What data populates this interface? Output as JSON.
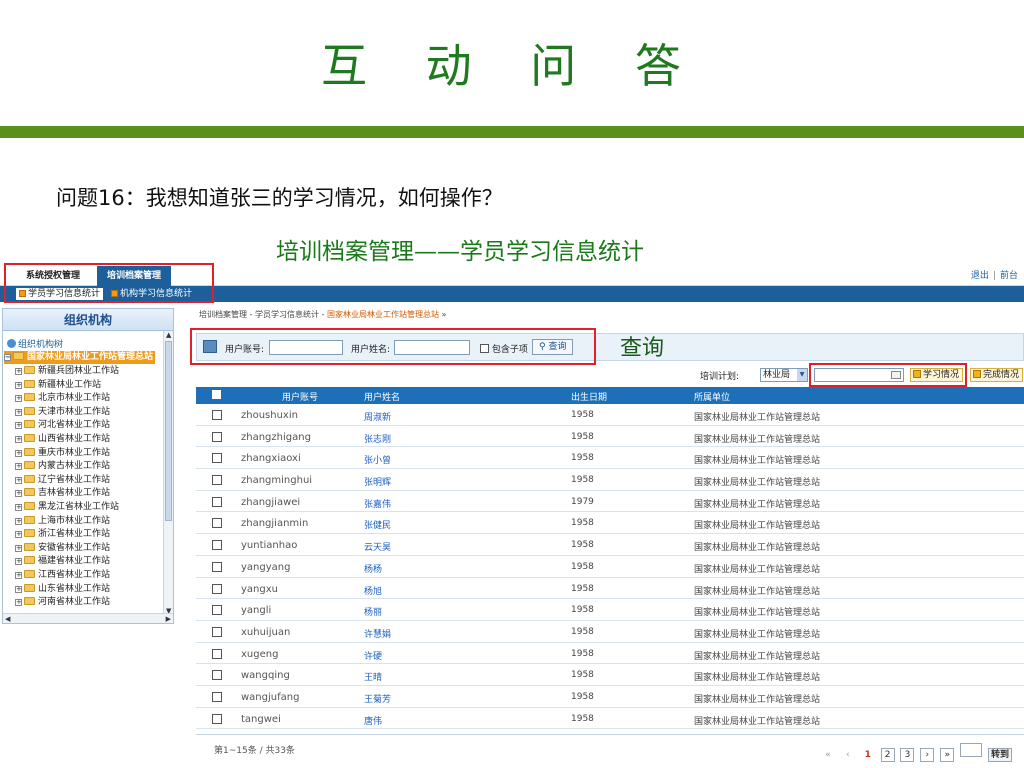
{
  "slide": {
    "title": "互 动 问 答",
    "question": "问题16：我想知道张三的学习情况，如何操作？",
    "subtitle": "培训档案管理——学员学习信息统计",
    "annotation_query": "查询"
  },
  "header": {
    "tabs": [
      {
        "label": "系统授权管理"
      },
      {
        "label": "培训档案管理"
      }
    ],
    "links": {
      "logout": "退出",
      "sep": "|",
      "home": "前台"
    }
  },
  "subnav": [
    {
      "label": "学员学习信息统计"
    },
    {
      "label": "机构学习信息统计"
    }
  ],
  "sidebar": {
    "title": "组织机构",
    "root": "组织机构树",
    "selected": "国家林业局林业工作站管理总站",
    "items": [
      "新疆兵团林业工作站",
      "新疆林业工作站",
      "北京市林业工作站",
      "天津市林业工作站",
      "河北省林业工作站",
      "山西省林业工作站",
      "重庆市林业工作站",
      "内蒙古林业工作站",
      "辽宁省林业工作站",
      "吉林省林业工作站",
      "黑龙江省林业工作站",
      "上海市林业工作站",
      "浙江省林业工作站",
      "安徽省林业工作站",
      "福建省林业工作站",
      "江西省林业工作站",
      "山东省林业工作站",
      "河南省林业工作站"
    ]
  },
  "breadcrumb": {
    "path": "培训档案管理 - 学员学习信息统计 - ",
    "current": "国家林业局林业工作站管理总站",
    "tail": " »"
  },
  "search": {
    "account_label": "用户账号:",
    "name_label": "用户姓名:",
    "include_label": "包含子项",
    "query_button": "查询"
  },
  "plan": {
    "label": "培训计划:",
    "selected": "林业局",
    "study_button": "学习情况",
    "complete_button": "完成情况"
  },
  "table": {
    "headers": [
      "用户账号",
      "用户姓名",
      "出生日期",
      "所属单位"
    ],
    "rows": [
      {
        "account": "zhoushuxin",
        "name": "周淑新",
        "birth": "1958",
        "unit": "国家林业局林业工作站管理总站"
      },
      {
        "account": "zhangzhigang",
        "name": "张志刚",
        "birth": "1958",
        "unit": "国家林业局林业工作站管理总站"
      },
      {
        "account": "zhangxiaoxi",
        "name": "张小曾",
        "birth": "1958",
        "unit": "国家林业局林业工作站管理总站"
      },
      {
        "account": "zhangminghui",
        "name": "张明辉",
        "birth": "1958",
        "unit": "国家林业局林业工作站管理总站"
      },
      {
        "account": "zhangjiawei",
        "name": "张嘉伟",
        "birth": "1979",
        "unit": "国家林业局林业工作站管理总站"
      },
      {
        "account": "zhangjianmin",
        "name": "张健民",
        "birth": "1958",
        "unit": "国家林业局林业工作站管理总站"
      },
      {
        "account": "yuntianhao",
        "name": "云天昊",
        "birth": "1958",
        "unit": "国家林业局林业工作站管理总站"
      },
      {
        "account": "yangyang",
        "name": "杨杨",
        "birth": "1958",
        "unit": "国家林业局林业工作站管理总站"
      },
      {
        "account": "yangxu",
        "name": "杨旭",
        "birth": "1958",
        "unit": "国家林业局林业工作站管理总站"
      },
      {
        "account": "yangli",
        "name": "杨丽",
        "birth": "1958",
        "unit": "国家林业局林业工作站管理总站"
      },
      {
        "account": "xuhuijuan",
        "name": "许慧娟",
        "birth": "1958",
        "unit": "国家林业局林业工作站管理总站"
      },
      {
        "account": "xugeng",
        "name": "许硬",
        "birth": "1958",
        "unit": "国家林业局林业工作站管理总站"
      },
      {
        "account": "wangqing",
        "name": "王晴",
        "birth": "1958",
        "unit": "国家林业局林业工作站管理总站"
      },
      {
        "account": "wangjufang",
        "name": "王菊芳",
        "birth": "1958",
        "unit": "国家林业局林业工作站管理总站"
      },
      {
        "account": "tangwei",
        "name": "唐伟",
        "birth": "1958",
        "unit": "国家林业局林业工作站管理总站"
      }
    ]
  },
  "footer": {
    "info": "第1~15条 / 共33条",
    "pager": {
      "first": "«",
      "prev": "‹",
      "pages": [
        "1",
        "2",
        "3"
      ],
      "next": "›",
      "last": "»",
      "go": "转到"
    }
  },
  "colors": {
    "accent": "#1d6fb8",
    "title_green": "#1f7a1f",
    "bar_green": "#5a8f1c",
    "highlight_red": "#e0202a",
    "selected_orange": "#f09a1a"
  }
}
